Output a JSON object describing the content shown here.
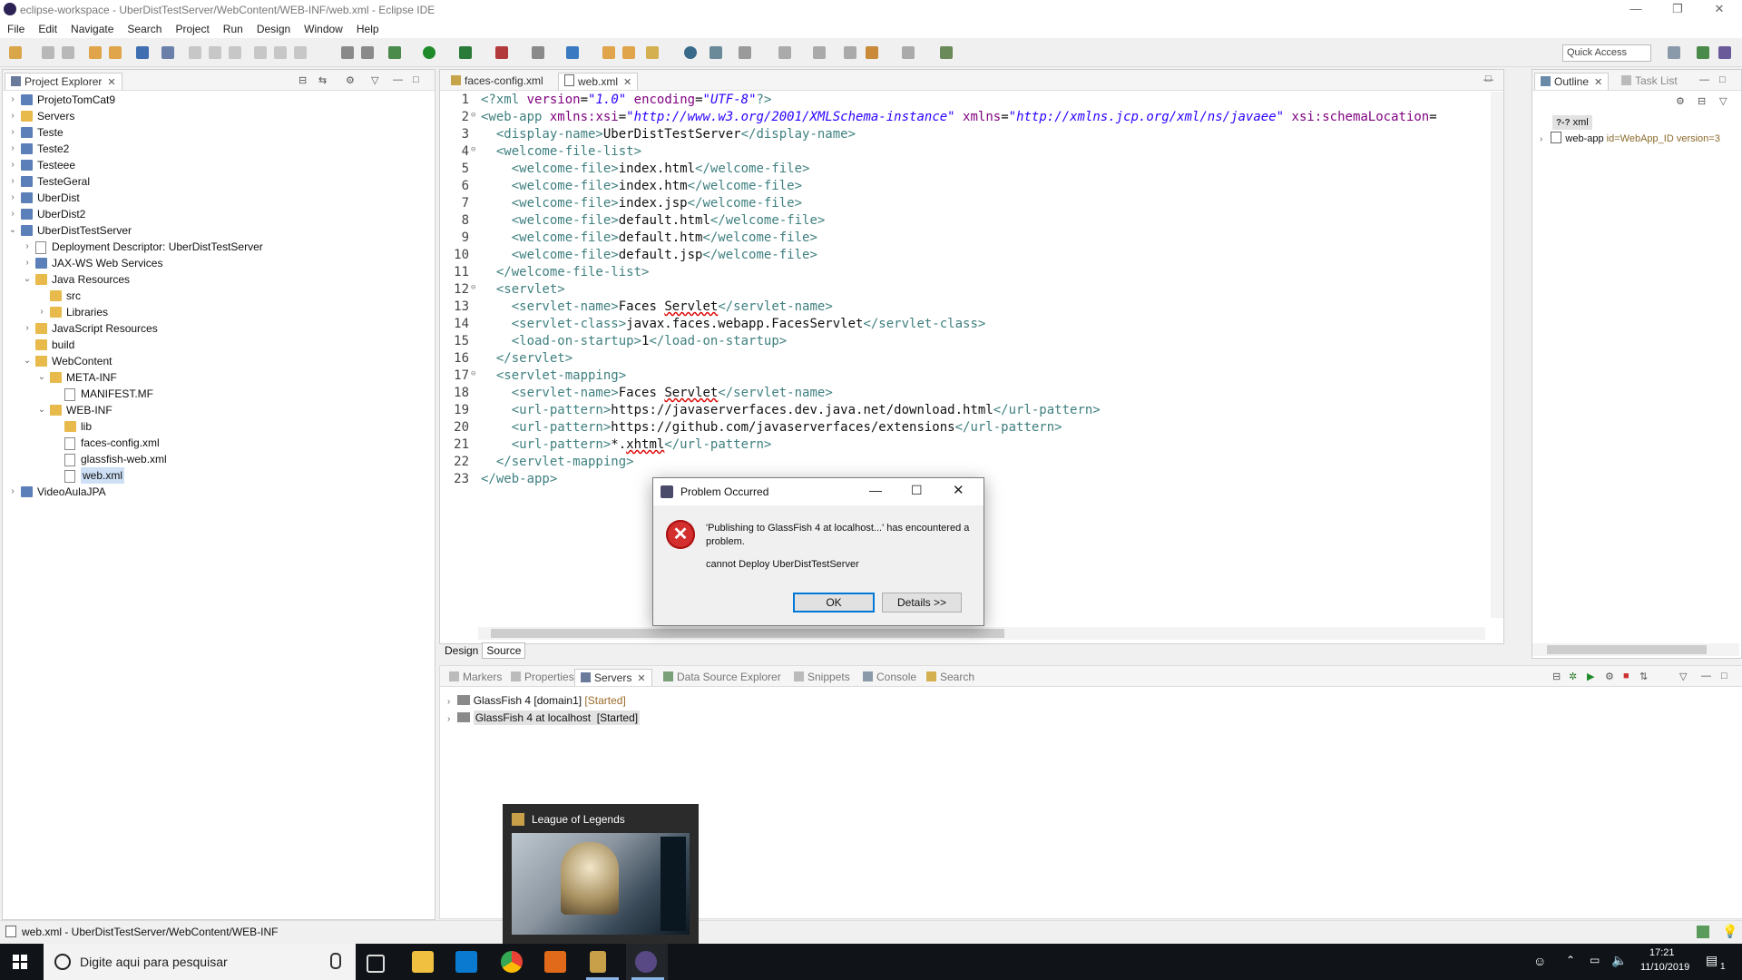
{
  "window": {
    "title": "eclipse-workspace - UberDistTestServer/WebContent/WEB-INF/web.xml - Eclipse IDE",
    "min": "—",
    "restore": "❐",
    "close": "✕"
  },
  "menu": [
    "File",
    "Edit",
    "Navigate",
    "Search",
    "Project",
    "Run",
    "Design",
    "Window",
    "Help"
  ],
  "toolbar": {
    "quick_access": "Quick Access"
  },
  "project_explorer": {
    "tab": "Project Explorer",
    "items": [
      {
        "label": "ProjetoTomCat9",
        "depth": 0,
        "tw": "›",
        "icon": "proj"
      },
      {
        "label": "Servers",
        "depth": 0,
        "tw": "›",
        "icon": "folder"
      },
      {
        "label": "Teste",
        "depth": 0,
        "tw": "›",
        "icon": "proj"
      },
      {
        "label": "Teste2",
        "depth": 0,
        "tw": "›",
        "icon": "proj"
      },
      {
        "label": "Testeee",
        "depth": 0,
        "tw": "›",
        "icon": "proj"
      },
      {
        "label": "TesteGeral",
        "depth": 0,
        "tw": "›",
        "icon": "proj"
      },
      {
        "label": "UberDist",
        "depth": 0,
        "tw": "›",
        "icon": "proj"
      },
      {
        "label": "UberDist2",
        "depth": 0,
        "tw": "›",
        "icon": "proj"
      },
      {
        "label": "UberDistTestServer",
        "depth": 0,
        "tw": "⌄",
        "icon": "proj"
      },
      {
        "label": "Deployment Descriptor: UberDistTestServer",
        "depth": 1,
        "tw": "›",
        "icon": "file"
      },
      {
        "label": "JAX-WS Web Services",
        "depth": 1,
        "tw": "›",
        "icon": "proj"
      },
      {
        "label": "Java Resources",
        "depth": 1,
        "tw": "⌄",
        "icon": "folder"
      },
      {
        "label": "src",
        "depth": 2,
        "tw": "",
        "icon": "folder"
      },
      {
        "label": "Libraries",
        "depth": 2,
        "tw": "›",
        "icon": "folder"
      },
      {
        "label": "JavaScript Resources",
        "depth": 1,
        "tw": "›",
        "icon": "folder"
      },
      {
        "label": "build",
        "depth": 1,
        "tw": "",
        "icon": "folder"
      },
      {
        "label": "WebContent",
        "depth": 1,
        "tw": "⌄",
        "icon": "folder"
      },
      {
        "label": "META-INF",
        "depth": 2,
        "tw": "⌄",
        "icon": "folder"
      },
      {
        "label": "MANIFEST.MF",
        "depth": 3,
        "tw": "",
        "icon": "file"
      },
      {
        "label": "WEB-INF",
        "depth": 2,
        "tw": "⌄",
        "icon": "folder"
      },
      {
        "label": "lib",
        "depth": 3,
        "tw": "",
        "icon": "folder"
      },
      {
        "label": "faces-config.xml",
        "depth": 3,
        "tw": "",
        "icon": "file"
      },
      {
        "label": "glassfish-web.xml",
        "depth": 3,
        "tw": "",
        "icon": "file"
      },
      {
        "label": "web.xml",
        "depth": 3,
        "tw": "",
        "icon": "file",
        "selected": true
      },
      {
        "label": "VideoAulaJPA",
        "depth": 0,
        "tw": "›",
        "icon": "proj"
      }
    ]
  },
  "editor": {
    "tabs": [
      "faces-config.xml",
      "web.xml"
    ],
    "bottom_tabs": [
      "Design",
      "Source"
    ],
    "lines": [
      {
        "n": "1",
        "fold": "",
        "html": "<span class='tag'>&lt;?xml</span> <span class='attr'>version</span>=<span class='str'>\"1.0\"</span> <span class='attr'>encoding</span>=<span class='str'>\"UTF-8\"</span><span class='tag'>?&gt;</span>"
      },
      {
        "n": "2",
        "fold": "⊖",
        "html": "<span class='tag'>&lt;web-app</span> <span class='attr'>xmlns:xsi</span>=<span class='str'>\"http://www.w3.org/2001/XMLSchema-instance\"</span> <span class='attr'>xmlns</span>=<span class='str'>\"http://xmlns.jcp.org/xml/ns/javaee\"</span> <span class='attr'>xsi:schemaLocation</span>="
      },
      {
        "n": "3",
        "fold": "",
        "html": "  <span class='tag'>&lt;display-name&gt;</span>UberDistTestServer<span class='tag'>&lt;/display-name&gt;</span>"
      },
      {
        "n": "4",
        "fold": "⊖",
        "html": "  <span class='tag'>&lt;welcome-file-list&gt;</span>"
      },
      {
        "n": "5",
        "fold": "",
        "html": "    <span class='tag'>&lt;welcome-file&gt;</span>index.html<span class='tag'>&lt;/welcome-file&gt;</span>"
      },
      {
        "n": "6",
        "fold": "",
        "html": "    <span class='tag'>&lt;welcome-file&gt;</span>index.htm<span class='tag'>&lt;/welcome-file&gt;</span>"
      },
      {
        "n": "7",
        "fold": "",
        "html": "    <span class='tag'>&lt;welcome-file&gt;</span>index.jsp<span class='tag'>&lt;/welcome-file&gt;</span>"
      },
      {
        "n": "8",
        "fold": "",
        "html": "    <span class='tag'>&lt;welcome-file&gt;</span>default.html<span class='tag'>&lt;/welcome-file&gt;</span>"
      },
      {
        "n": "9",
        "fold": "",
        "html": "    <span class='tag'>&lt;welcome-file&gt;</span>default.htm<span class='tag'>&lt;/welcome-file&gt;</span>"
      },
      {
        "n": "10",
        "fold": "",
        "html": "    <span class='tag'>&lt;welcome-file&gt;</span>default.jsp<span class='tag'>&lt;/welcome-file&gt;</span>"
      },
      {
        "n": "11",
        "fold": "",
        "html": "  <span class='tag'>&lt;/welcome-file-list&gt;</span>"
      },
      {
        "n": "12",
        "fold": "⊖",
        "html": "  <span class='tag'>&lt;servlet&gt;</span>"
      },
      {
        "n": "13",
        "fold": "",
        "html": "    <span class='tag'>&lt;servlet-name&gt;</span>Faces <span class='err'>Servlet</span><span class='tag'>&lt;/servlet-name&gt;</span>"
      },
      {
        "n": "14",
        "fold": "",
        "html": "    <span class='tag'>&lt;servlet-class&gt;</span>javax.faces.webapp.FacesServlet<span class='tag'>&lt;/servlet-class&gt;</span>"
      },
      {
        "n": "15",
        "fold": "",
        "html": "    <span class='tag'>&lt;load-on-startup&gt;</span>1<span class='tag'>&lt;/load-on-startup&gt;</span>"
      },
      {
        "n": "16",
        "fold": "",
        "html": "  <span class='tag'>&lt;/servlet&gt;</span>"
      },
      {
        "n": "17",
        "fold": "⊖",
        "html": "  <span class='tag'>&lt;servlet-mapping&gt;</span>"
      },
      {
        "n": "18",
        "fold": "",
        "html": "    <span class='tag'>&lt;servlet-name&gt;</span>Faces <span class='err'>Servlet</span><span class='tag'>&lt;/servlet-name&gt;</span>"
      },
      {
        "n": "19",
        "fold": "",
        "html": "    <span class='tag'>&lt;url-pattern&gt;</span>https://javaserverfaces.dev.java.net/download.html<span class='tag'>&lt;/url-pattern&gt;</span>"
      },
      {
        "n": "20",
        "fold": "",
        "html": "    <span class='tag'>&lt;url-pattern&gt;</span>https://github.com/javaserverfaces/extensions<span class='tag'>&lt;/url-pattern&gt;</span>"
      },
      {
        "n": "21",
        "fold": "",
        "html": "    <span class='tag'>&lt;url-pattern&gt;</span>*.<span class='err'>xhtml</span><span class='tag'>&lt;/url-pattern&gt;</span>"
      },
      {
        "n": "22",
        "fold": "",
        "html": "  <span class='tag'>&lt;/servlet-mapping&gt;</span>"
      },
      {
        "n": "23",
        "fold": "",
        "html": "<span class='tag'>&lt;/web-app&gt;</span>"
      }
    ]
  },
  "outline": {
    "tabs": [
      "Outline",
      "Task List"
    ],
    "items": [
      "xml",
      "web-app",
      "id=WebApp_ID version=3"
    ]
  },
  "dialog": {
    "title": "Problem Occurred",
    "message": "'Publishing to GlassFish 4 at localhost...' has encountered a problem.",
    "detail": "cannot Deploy UberDistTestServer",
    "ok": "OK",
    "details": "Details >>"
  },
  "servers_panel": {
    "tabs": [
      "Markers",
      "Properties",
      "Servers",
      "Data Source Explorer",
      "Snippets",
      "Console",
      "Search"
    ],
    "rows": [
      {
        "name": "GlassFish 4 [domain1]",
        "status": "[Started]"
      },
      {
        "name": "GlassFish 4 at localhost",
        "status": "[Started]"
      }
    ]
  },
  "status_bar": "web.xml - UberDistTestServer/WebContent/WEB-INF",
  "taskbar": {
    "search_placeholder": "Digite aqui para pesquisar",
    "time": "17:21",
    "date": "11/10/2019",
    "notif_count": "1",
    "preview_title": "League of Legends"
  }
}
